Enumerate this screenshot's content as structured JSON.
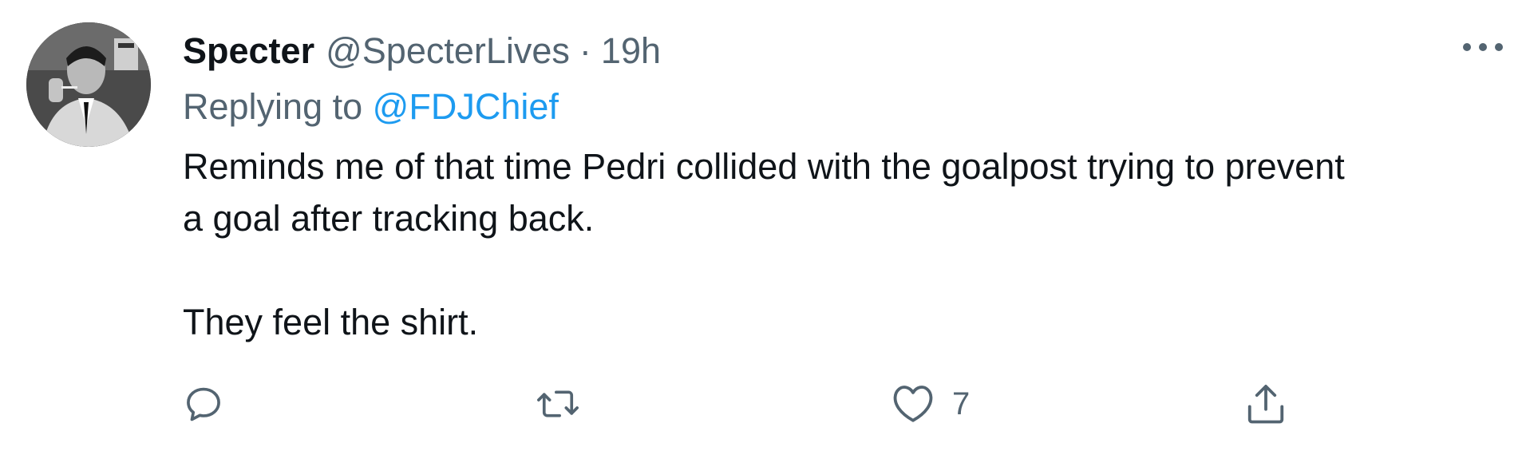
{
  "tweet": {
    "display_name": "Specter",
    "handle": "@SpecterLives",
    "separator": "·",
    "time": "19h",
    "reply_prefix": "Replying to",
    "reply_to": "@FDJChief",
    "body_line1": "Reminds me of that time Pedri collided with the goalpost trying to prevent",
    "body_line2": "a goal after tracking back.",
    "body_line3": "They feel the shirt.",
    "like_count": "7"
  },
  "icons": {
    "avatar": "avatar-photo",
    "more": "more-icon",
    "reply": "reply-icon",
    "retweet": "retweet-icon",
    "like": "heart-icon",
    "share": "share-icon"
  },
  "colors": {
    "text_primary": "#0f1419",
    "text_secondary": "#536471",
    "link": "#1d9bf0"
  }
}
